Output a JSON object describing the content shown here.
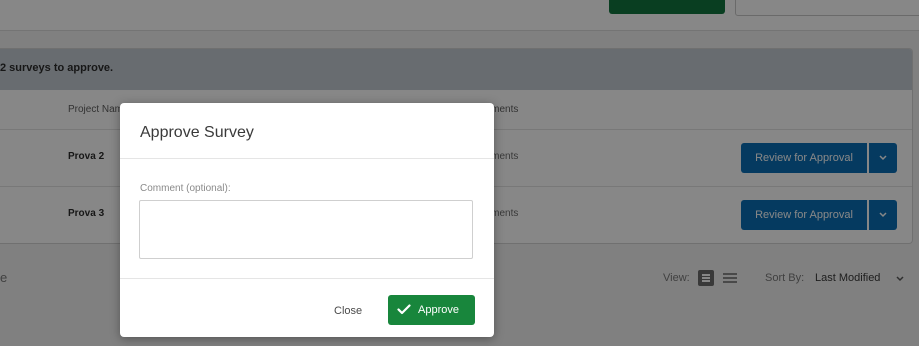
{
  "panel": {
    "header_text": "2 surveys to approve.",
    "columns": {
      "project_name": "Project Name",
      "comments": "Comments"
    },
    "rows": [
      {
        "name": "Prova 2",
        "comments": "Comments",
        "action": "Review for Approval"
      },
      {
        "name": "Prova 3",
        "comments": "Comments",
        "action": "Review for Approval"
      }
    ]
  },
  "footer": {
    "left_text": "e",
    "view_label": "View:",
    "sort_label": "Sort By:",
    "sort_value": "Last Modified"
  },
  "modal": {
    "title": "Approve Survey",
    "comment_label": "Comment (optional):",
    "comment_value": "",
    "close_label": "Close",
    "approve_label": "Approve"
  },
  "colors": {
    "primary_blue": "#0a6fb6",
    "approve_green": "#18863c",
    "header_gray": "#c4ccd4"
  },
  "icons": {
    "approve": "checkmark-icon",
    "dropdown": "chevron-down-icon",
    "view_grid": "grid-view-icon",
    "view_list": "list-view-icon"
  }
}
